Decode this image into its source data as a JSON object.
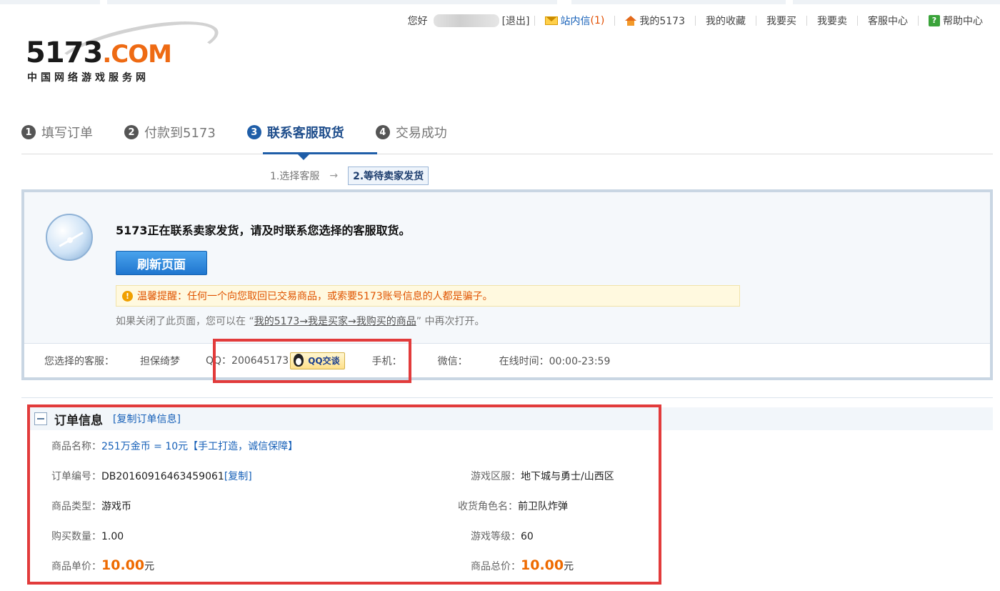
{
  "topnav": {
    "greeting": "您好",
    "logout": "[退出]",
    "messages_label": "站内信",
    "messages_count": "(1)",
    "my_5173": "我的5173",
    "favorites": "我的收藏",
    "buy": "我要买",
    "sell": "我要卖",
    "service_center": "客服中心",
    "help_center": "帮助中心"
  },
  "logo": {
    "main_number": "5173",
    "main_suffix": ".COM",
    "subtitle": "中国网络游戏服务网"
  },
  "steps": [
    {
      "num": "1",
      "label": "填写订单"
    },
    {
      "num": "2",
      "label": "付款到5173"
    },
    {
      "num": "3",
      "label": "联系客服取货"
    },
    {
      "num": "4",
      "label": "交易成功"
    }
  ],
  "substeps": {
    "first": "1.选择客服",
    "arrow": "→",
    "current": "2.等待卖家发货"
  },
  "status": {
    "title": "5173正在联系卖家发货，请及时联系您选择的客服取货。",
    "refresh_button": "刷新页面",
    "warning_label": "温馨提醒：",
    "warning_text": "任何一个向您取回已交易商品，或索要5173账号信息的人都是骗子。",
    "reopen_prefix": "如果关闭了此页面，您可以在 “",
    "reopen_path": "我的5173→我是买家→我购买的商品",
    "reopen_suffix": "” 中再次打开。"
  },
  "service": {
    "chosen_label": "您选择的客服：",
    "name": "担保绮梦",
    "qq_label": "QQ：",
    "qq_number": "200645173",
    "qq_chat_button": "QQ交谈",
    "phone_label": "手机：",
    "wechat_label": "微信：",
    "online_label": "在线时间：",
    "online_hours": "00:00-23:59"
  },
  "order": {
    "title": "订单信息",
    "copy_info": "[复制订单信息]",
    "product_name_label": "商品名称：",
    "product_name": "251万金币 = 10元【手工打造，诚信保障】",
    "order_no_label": "订单编号：",
    "order_no": "DB20160916463459061",
    "copy": "[复制]",
    "server_label": "游戏区服：",
    "server": "地下城与勇士/山西区",
    "type_label": "商品类型：",
    "type": "游戏币",
    "role_label": "收货角色名：",
    "role": "前卫队炸弹",
    "qty_label": "购买数量：",
    "qty": "1.00",
    "level_label": "游戏等级：",
    "level": "60",
    "unit_price_label": "商品单价：",
    "unit_price": "10.00",
    "total_label": "商品总价：",
    "total": "10.00",
    "currency": "元"
  },
  "colors": {
    "accent_blue": "#1f5ea8",
    "link_blue": "#1660b8",
    "price_orange": "#ee6a00",
    "highlight_red": "#e23b3b"
  }
}
